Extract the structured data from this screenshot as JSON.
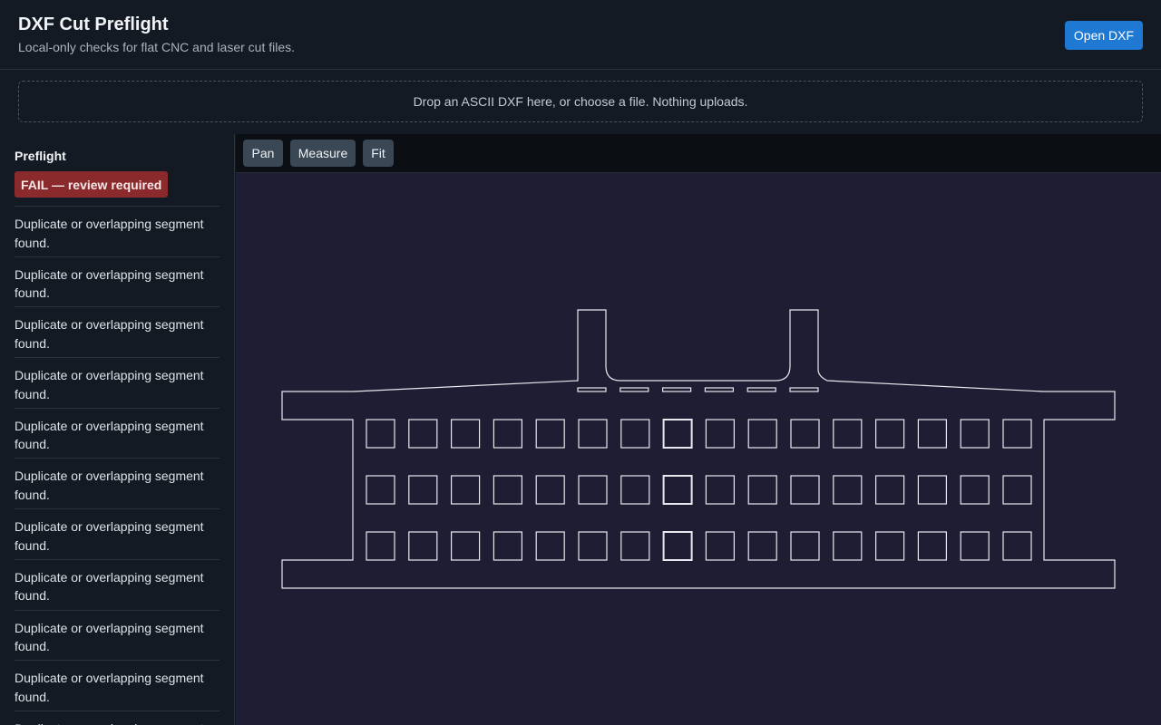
{
  "header": {
    "title": "DXF Cut Preflight",
    "subtitle": "Local-only checks for flat CNC and laser cut files.",
    "open_button": "Open DXF"
  },
  "dropzone": {
    "text": "Drop an ASCII DXF here, or choose a file. Nothing uploads."
  },
  "sidebar": {
    "heading": "Preflight",
    "status": "FAIL — review required",
    "issues": [
      "Duplicate or overlapping segment found.",
      "Duplicate or overlapping segment found.",
      "Duplicate or overlapping segment found.",
      "Duplicate or overlapping segment found.",
      "Duplicate or overlapping segment found.",
      "Duplicate or overlapping segment found.",
      "Duplicate or overlapping segment found.",
      "Duplicate or overlapping segment found.",
      "Duplicate or overlapping segment found.",
      "Duplicate or overlapping segment found.",
      "Duplicate or overlapping segment found."
    ]
  },
  "toolbar": {
    "pan": "Pan",
    "measure": "Measure",
    "fit": "Fit"
  },
  "colors": {
    "accent": "#1f78d1",
    "fail": "#8b2a2c",
    "canvas": "#1e1d33",
    "stroke": "#e8e8ee"
  }
}
